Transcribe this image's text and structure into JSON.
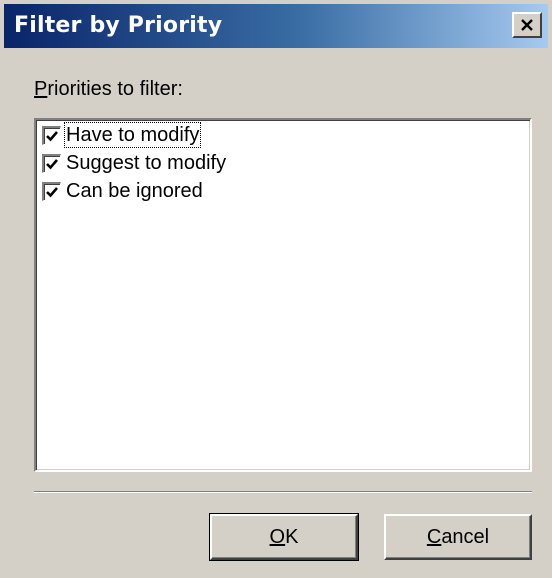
{
  "dialog": {
    "title": "Filter by Priority",
    "close_icon": "close-icon"
  },
  "filter": {
    "label": "Priorities to filter:",
    "items": [
      {
        "label": "Have to modify",
        "checked": true,
        "focused": true
      },
      {
        "label": "Suggest to modify",
        "checked": true,
        "focused": false
      },
      {
        "label": "Can be ignored",
        "checked": true,
        "focused": false
      }
    ]
  },
  "buttons": {
    "ok_label": "OK",
    "cancel_label": "Cancel"
  },
  "colors": {
    "title_start": "#0a246a",
    "title_end": "#a6caf0",
    "face": "#d4d0c8"
  }
}
